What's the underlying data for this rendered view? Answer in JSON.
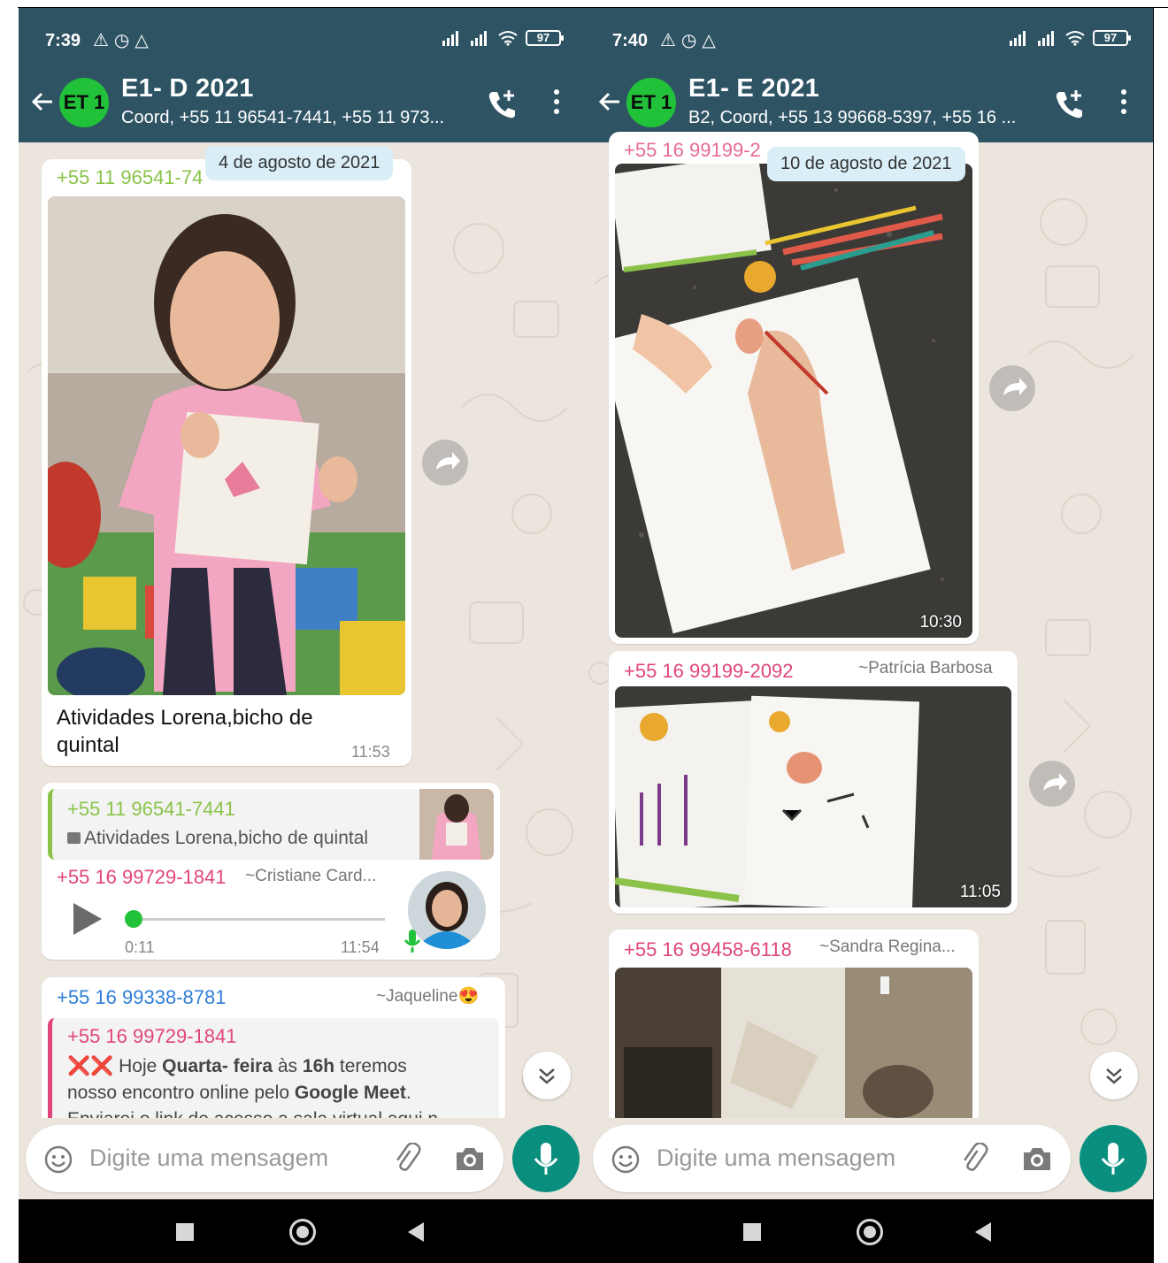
{
  "left": {
    "status": {
      "time": "7:39",
      "battery": "97"
    },
    "header": {
      "avatar": "ET 1",
      "title": "E1- D 2021",
      "subtitle": "Coord, +55 11 96541-7441, +55 11 973..."
    },
    "date_chip": "4 de agosto de 2021",
    "msg1": {
      "sender_partial": "+55 11 96541-74",
      "caption": "Atividades Lorena,bicho  de quintal",
      "time": "11:53"
    },
    "msg2": {
      "quote_sender": "+55 11 96541-7441",
      "quote_text": "Atividades Lorena,bicho  de quintal",
      "sender": "+55 16 99729-1841",
      "sender_name": "~Cristiane Card...",
      "audio_duration": "0:11",
      "time": "11:54"
    },
    "msg3": {
      "sender": "+55 16 99338-8781",
      "sender_name": "~Jaqueline😍",
      "quote_sender": "+55 16 99729-1841",
      "quote_line1_prefix": "❌❌ Hoje ",
      "quote_line1_bold1": "Quarta- feira",
      "quote_line1_mid": " às ",
      "quote_line1_bold2": "16h",
      "quote_line1_suffix": " teremos",
      "quote_line2_prefix": "nosso encontro online pelo ",
      "quote_line2_bold": "Google Meet",
      "quote_line2_suffix": ".",
      "quote_line3": "Enviarei o link de acesso a sala virtual aqui n..."
    },
    "input_placeholder": "Digite uma mensagem"
  },
  "right": {
    "status": {
      "time": "7:40",
      "battery": "97"
    },
    "header": {
      "avatar": "ET 1",
      "title": "E1- E 2021",
      "subtitle": "B2, Coord, +55 13 99668-5397, +55 16 ..."
    },
    "date_chip": "10 de agosto de 2021",
    "top_partial": "+55 16 99199-2",
    "msg1": {
      "time": "10:30"
    },
    "msg2": {
      "sender": "+55 16 99199-2092",
      "sender_name": "~Patrícia Barbosa",
      "time": "11:05"
    },
    "msg3": {
      "sender": "+55 16 99458-6118",
      "sender_name": "~Sandra Regina..."
    },
    "input_placeholder": "Digite uma mensagem"
  },
  "colors": {
    "header": "#2e5464",
    "accent_green": "#0a8f7e",
    "avatar_green": "#22c13a",
    "chat_bg": "#ece5dd",
    "date_chip": "#d9eef7"
  },
  "icons": [
    "back-arrow-icon",
    "add-call-icon",
    "more-vert-icon",
    "emoji-icon",
    "attach-icon",
    "camera-icon",
    "mic-icon",
    "forward-icon",
    "chevron-down-icon",
    "play-icon",
    "wifi-icon",
    "signal-icon",
    "battery-icon"
  ]
}
